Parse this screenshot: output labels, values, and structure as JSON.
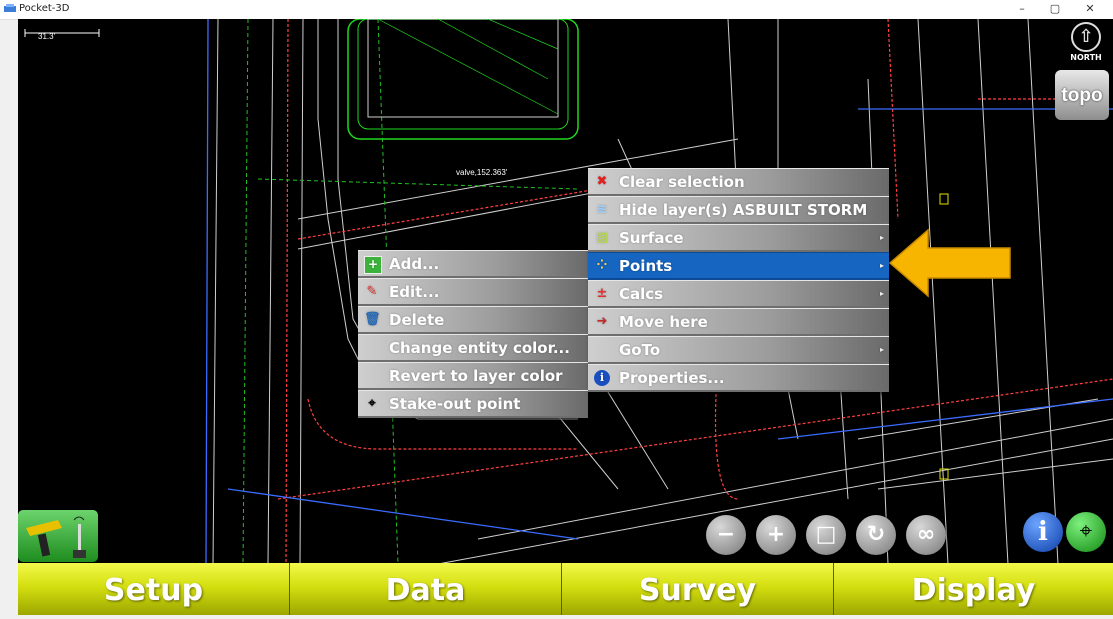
{
  "window": {
    "title": "Pocket-3D",
    "minimize": "–",
    "maximize": "▢",
    "close": "✕"
  },
  "map": {
    "scale_label": "31.3'",
    "north_label": "NORTH",
    "topo_label": "topo",
    "point_label": "valve,152.363'"
  },
  "context_menu": {
    "items": [
      {
        "label": "Clear selection",
        "icon": "clear-selection-icon",
        "submenu": false
      },
      {
        "label": "Hide layer(s) ASBUILT STORM",
        "icon": "hide-layer-icon",
        "submenu": false
      },
      {
        "label": "Surface",
        "icon": "surface-icon",
        "submenu": true
      },
      {
        "label": "Points",
        "icon": "points-icon",
        "submenu": true,
        "selected": true
      },
      {
        "label": "Calcs",
        "icon": "calcs-icon",
        "submenu": true
      },
      {
        "label": "Move here",
        "icon": "move-here-icon",
        "submenu": false
      },
      {
        "label": "GoTo",
        "icon": "",
        "submenu": true
      },
      {
        "label": "Properties...",
        "icon": "info-icon",
        "submenu": false
      }
    ]
  },
  "points_submenu": {
    "items": [
      {
        "label": "Add...",
        "icon": "add-icon"
      },
      {
        "label": "Edit...",
        "icon": "pencil-icon"
      },
      {
        "label": "Delete",
        "icon": "trash-icon"
      },
      {
        "label": "Change entity color...",
        "icon": ""
      },
      {
        "label": "Revert to layer color",
        "icon": ""
      },
      {
        "label": "Stake-out point",
        "icon": "crosshair-icon"
      }
    ]
  },
  "zoom_controls": [
    "zoom-out",
    "zoom-in",
    "zoom-extents",
    "rotate",
    "zoom-all"
  ],
  "bottom_tabs": [
    "Setup",
    "Data",
    "Survey",
    "Display"
  ],
  "colors": {
    "menu_highlight": "#1665c0",
    "tab_yellow": "#d4df10",
    "arrow_orange": "#f7b500",
    "map_background": "#000000"
  }
}
